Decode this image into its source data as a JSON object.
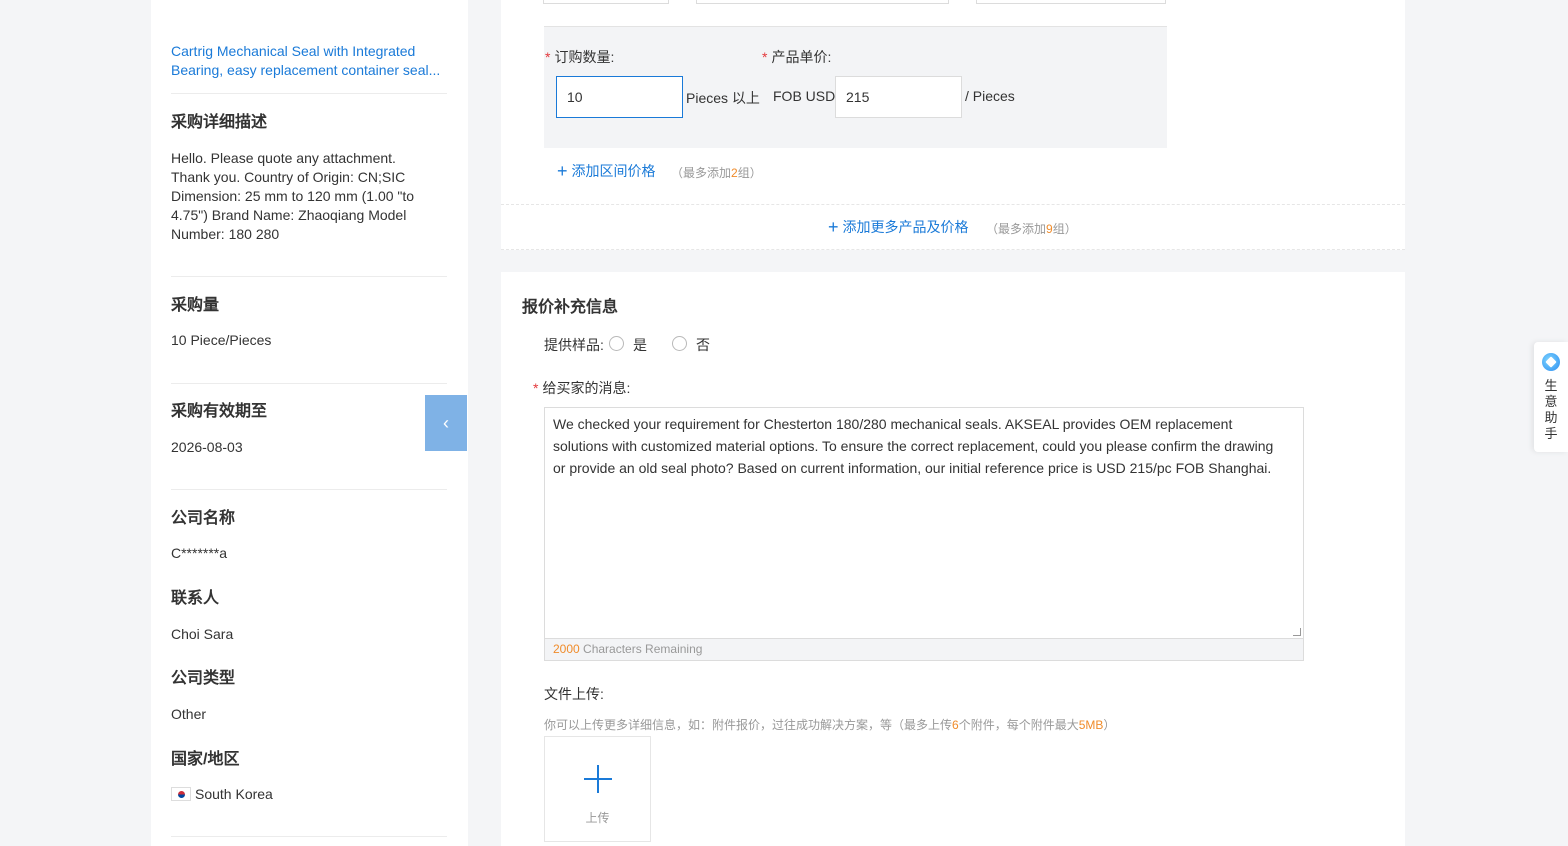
{
  "sidebar": {
    "product_link_line1": "Cartrig Mechanical Seal with Integrated",
    "product_link_line2": "Bearing, easy replacement container seal...",
    "detail_title": "采购详细描述",
    "detail_text": "Hello. Please quote any attachment. Thank you. Country of Origin: CN;SIC Dimension: 25 mm to 120 mm (1.00 \"to 4.75\") Brand Name: Zhaoqiang Model Number: 180 280",
    "quantity_title": "采购量",
    "quantity_value": "10 Piece/Pieces",
    "valid_title": "采购有效期至",
    "valid_value": "2026-08-03",
    "company_title": "公司名称",
    "company_value": "C*******a",
    "contact_title": "联系人",
    "contact_value": "Choi Sara",
    "company_type_title": "公司类型",
    "company_type_value": "Other",
    "country_title": "国家/地区",
    "country_value": "South Korea",
    "collapse_glyph": "‹"
  },
  "pricing": {
    "qty_label": "订购数量:",
    "price_label": "产品单价:",
    "qty_value": "10",
    "qty_unit": "Pieces 以上",
    "currency": "FOB USD",
    "price_value": "215",
    "price_unit": "/ Pieces",
    "required_mark": "*",
    "add_range_label": "添加区间价格",
    "add_range_hint_prefix": "（最多添加",
    "add_range_hint_num": "2",
    "add_range_hint_suffix": "组）",
    "add_more_label": "添加更多产品及价格",
    "add_more_hint_prefix": "（最多添加",
    "add_more_hint_num": "9",
    "add_more_hint_suffix": "组）",
    "plus_glyph": "+"
  },
  "supplement": {
    "title": "报价补充信息",
    "sample_label": "提供样品:",
    "sample_yes": "是",
    "sample_no": "否",
    "message_label": "给买家的消息:",
    "message_text": "We checked your requirement for Chesterton 180/280 mechanical seals. AKSEAL provides OEM replacement solutions with customized material options. To ensure the correct replacement, could you please confirm the drawing or provide an old seal photo? Based on current information, our initial reference price is USD 215/pc FOB Shanghai.",
    "remaining_num": "2000",
    "remaining_text": " Characters Remaining",
    "upload_label": "文件上传:",
    "upload_hint_prefix": "你可以上传更多详细信息，如：附件报价，过往成功解决方案，等（最多上传",
    "upload_hint_num1": "6",
    "upload_hint_mid": "个附件，每个附件最大",
    "upload_hint_num2": "5MB",
    "upload_hint_suffix": "）",
    "upload_button": "上传"
  },
  "assistant": {
    "label": "生意助手"
  }
}
